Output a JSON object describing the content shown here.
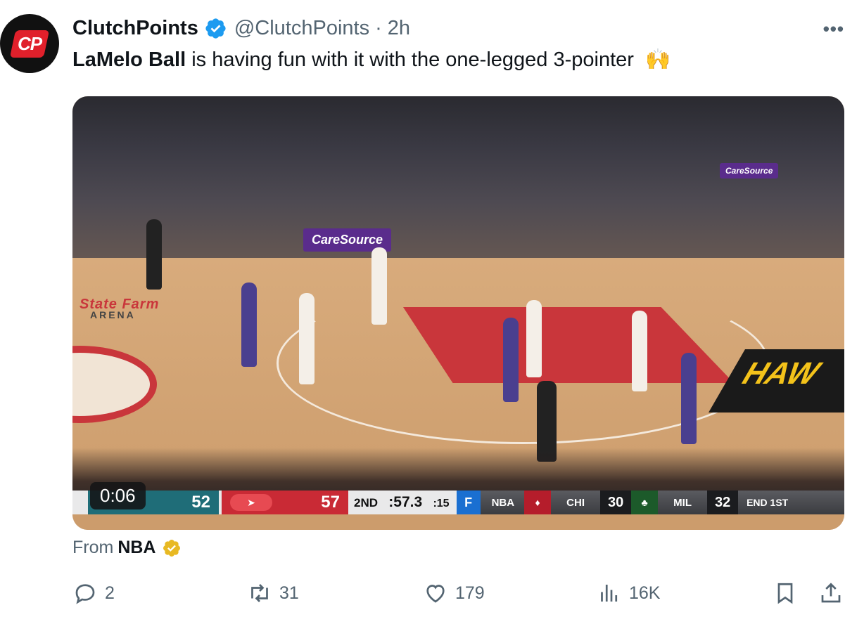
{
  "tweet": {
    "author_name": "ClutchPoints",
    "author_handle": "@ClutchPoints",
    "separator": "·",
    "time": "2h",
    "avatar_text": "CP",
    "more_label": "•••",
    "text_bold": "LaMelo Ball",
    "text_rest": "is having fun with it with the one-legged 3-pointer",
    "text_emoji": "🙌"
  },
  "media": {
    "timer": "0:06",
    "floor_logo": "State Farm",
    "floor_logo_sub": "ARENA",
    "ad_text": "CareSource",
    "ad_text_small": "CareSource",
    "hawks_text": "HAW",
    "scoreboard": {
      "home_score": "52",
      "away_score": "57",
      "quarter": "2ND",
      "clock": ":57.3",
      "shot_clock": ":15",
      "ticker_logo": "F",
      "ticker_league": "NBA",
      "ticker_team1": "CHI",
      "ticker_score1": "30",
      "ticker_team2": "MIL",
      "ticker_score2": "32",
      "ticker_status": "END 1ST"
    }
  },
  "source": {
    "prefix": "From",
    "name": "NBA"
  },
  "actions": {
    "replies": "2",
    "reposts": "31",
    "likes": "179",
    "views": "16K"
  },
  "colors": {
    "verified_blue": "#1d9bf0",
    "verified_gold": "#e8b923",
    "muted_text": "#536471"
  }
}
